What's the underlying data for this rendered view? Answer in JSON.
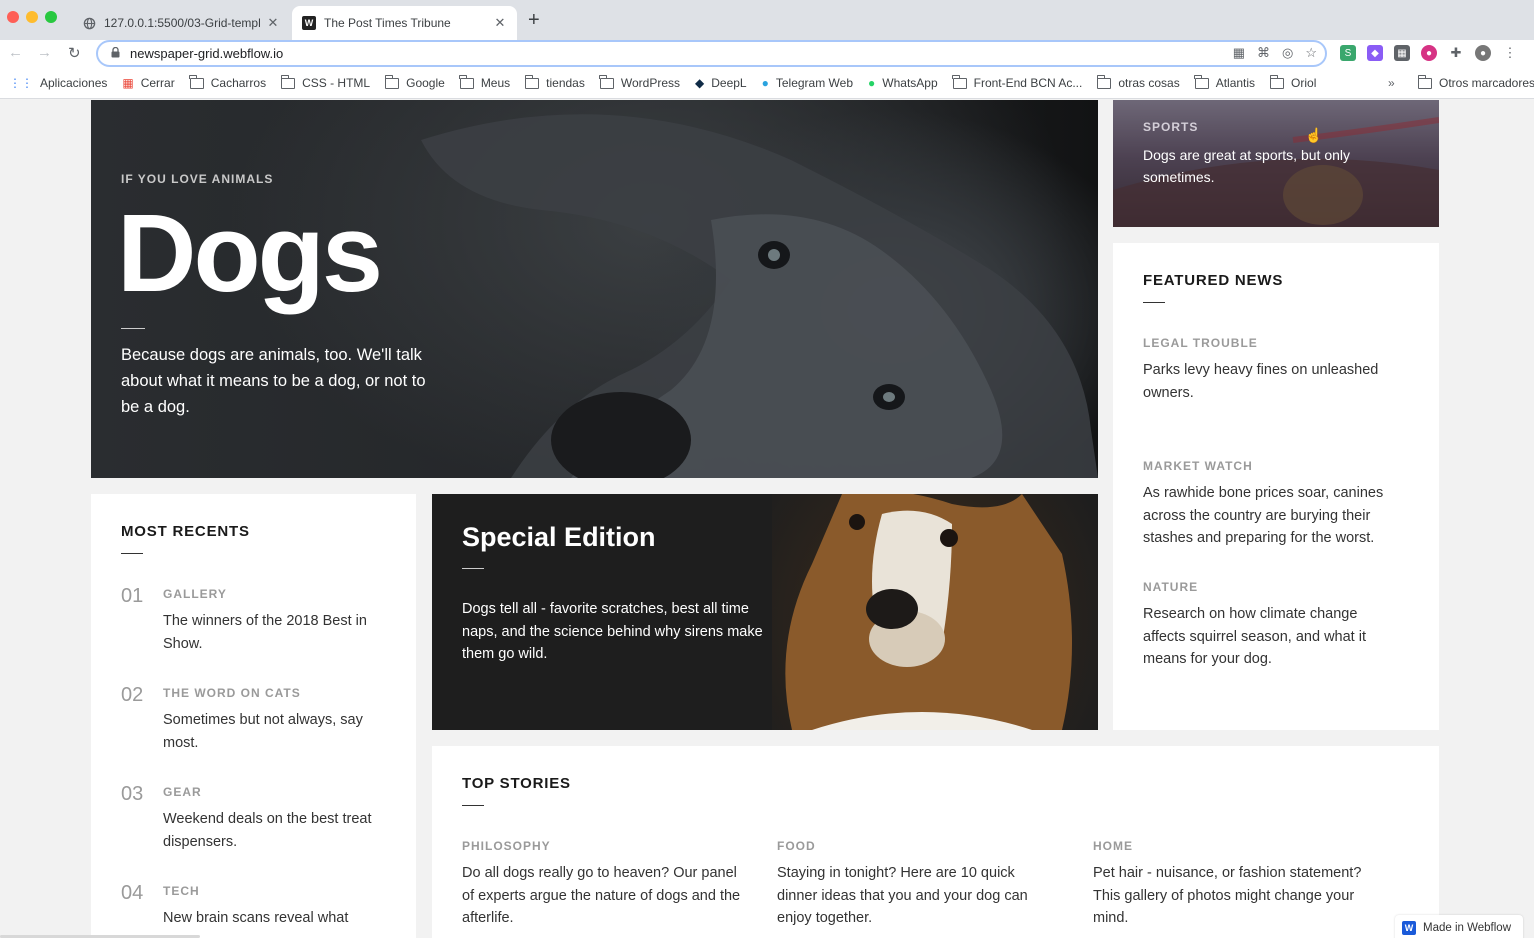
{
  "browser": {
    "tabs": [
      {
        "title": "127.0.0.1:5500/03-Grid-templ",
        "active": false
      },
      {
        "title": "The Post Times Tribune",
        "active": true
      }
    ],
    "new_tab": "+",
    "url": "newspaper-grid.webflow.io",
    "bookmarks": [
      {
        "label": "Aplicaciones",
        "icon": "apps-grid-icon"
      },
      {
        "label": "Cerrar",
        "icon": "grid-icon"
      },
      {
        "label": "Cacharros",
        "icon": "folder-icon"
      },
      {
        "label": "CSS - HTML",
        "icon": "folder-icon"
      },
      {
        "label": "Google",
        "icon": "folder-icon"
      },
      {
        "label": "Meus",
        "icon": "folder-icon"
      },
      {
        "label": "tiendas",
        "icon": "folder-icon"
      },
      {
        "label": "WordPress",
        "icon": "folder-icon"
      },
      {
        "label": "DeepL",
        "icon": "deepl-icon"
      },
      {
        "label": "Telegram Web",
        "icon": "telegram-icon"
      },
      {
        "label": "WhatsApp",
        "icon": "whatsapp-icon"
      },
      {
        "label": "Front-End BCN Ac...",
        "icon": "folder-icon"
      },
      {
        "label": "otras cosas",
        "icon": "folder-icon"
      },
      {
        "label": "Atlantis",
        "icon": "folder-icon"
      },
      {
        "label": "Oriol",
        "icon": "folder-icon"
      }
    ],
    "bookmarks_more": "»",
    "other_bookmarks": "Otros marcadores"
  },
  "hero": {
    "eyebrow": "IF YOU LOVE ANIMALS",
    "title": "Dogs",
    "description": "Because dogs are animals, too. We'll talk about what it means to be a dog, or not to be a dog."
  },
  "sports": {
    "eyebrow": "SPORTS",
    "text": "Dogs are great at sports, but only sometimes."
  },
  "featured": {
    "title": "FEATURED NEWS",
    "items": [
      {
        "category": "LEGAL TROUBLE",
        "text": "Parks levy heavy fines on unleashed owners."
      },
      {
        "category": "MARKET WATCH",
        "text": "As rawhide bone prices soar, canines across the country are burying their stashes and preparing for the worst."
      },
      {
        "category": "NATURE",
        "text": "Research on how climate change affects squirrel season, and what it means for your dog."
      }
    ]
  },
  "recents": {
    "title": "MOST RECENTS",
    "items": [
      {
        "num": "01",
        "category": "GALLERY",
        "text": "The winners of the 2018 Best in Show."
      },
      {
        "num": "02",
        "category": "THE WORD ON CATS",
        "text": "Sometimes but not always, say most."
      },
      {
        "num": "03",
        "category": "GEAR",
        "text": "Weekend deals on the best treat dispensers."
      },
      {
        "num": "04",
        "category": "TECH",
        "text": "New brain scans reveal what"
      }
    ]
  },
  "special": {
    "title": "Special Edition",
    "description": "Dogs tell all - favorite scratches, best all time naps, and the science behind why sirens make them go wild."
  },
  "top_stories": {
    "title": "TOP STORIES",
    "items": [
      {
        "category": "PHILOSOPHY",
        "text": "Do all dogs really go to heaven? Our panel of experts argue the nature of dogs and the afterlife."
      },
      {
        "category": "FOOD",
        "text": "Staying in tonight? Here are 10 quick dinner ideas that you and your dog can enjoy together."
      },
      {
        "category": "HOME",
        "text": "Pet hair - nuisance, or fashion statement? This gallery of photos might change your mind."
      }
    ]
  },
  "badge": {
    "label": "Made in Webflow"
  }
}
